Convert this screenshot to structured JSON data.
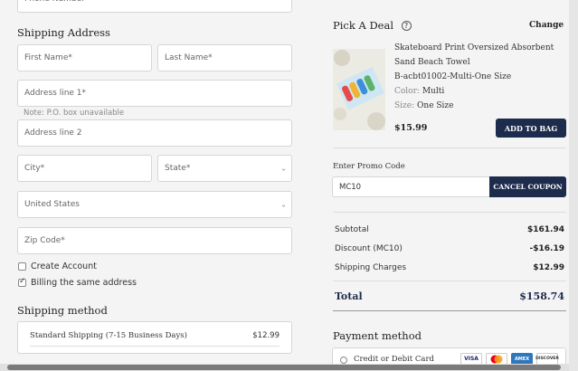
{
  "shipping_address": {
    "heading": "Shipping Address",
    "phone_placeholder": "Phone Number",
    "first_name_placeholder": "First Name*",
    "last_name_placeholder": "Last Name*",
    "address1_placeholder": "Address line 1*",
    "address_note": "Note: P.O. box unavailable",
    "address2_placeholder": "Address line 2",
    "city_placeholder": "City*",
    "state_placeholder": "State*",
    "country_value": "United States",
    "zip_placeholder": "Zip Code*"
  },
  "options": {
    "create_account": "Create Account",
    "create_account_checked": false,
    "billing_same": "Billing the same address",
    "billing_same_checked": true
  },
  "shipping_method": {
    "heading": "Shipping method",
    "option_label": "Standard Shipping (7-15 Business Days)",
    "option_price": "$12.99"
  },
  "deal": {
    "heading": "Pick A Deal",
    "help_icon": "question-circle-icon",
    "change_label": "Change",
    "change_icon": "refresh-icon",
    "product_name_line1": "Skateboard Print Oversized Absorbent",
    "product_name_line2": "Sand Beach Towel",
    "product_sku": "B-acbt01002-Multi-One Size",
    "color_label": "Color:",
    "color_value": "Multi",
    "size_label": "Size:",
    "size_value": "One Size",
    "price": "$15.99",
    "add_to_bag": "ADD TO BAG"
  },
  "promo": {
    "label": "Enter Promo Code",
    "code": "MC10",
    "cancel_button": "CANCEL COUPON"
  },
  "summary": {
    "subtotal_label": "Subtotal",
    "subtotal_value": "$161.94",
    "discount_label": "Discount (MC10)",
    "discount_value": "-$16.19",
    "shipping_label": "Shipping Charges",
    "shipping_value": "$12.99",
    "total_label": "Total",
    "total_value": "$158.74"
  },
  "payment": {
    "heading": "Payment method",
    "option_label": "Credit or Debit Card",
    "cards": [
      "VISA",
      "MC",
      "AMEX",
      "DISCOVER"
    ]
  },
  "colors": {
    "navy": "#1d2b4c",
    "background": "#f4f4f4",
    "border": "#d6d6d6"
  }
}
